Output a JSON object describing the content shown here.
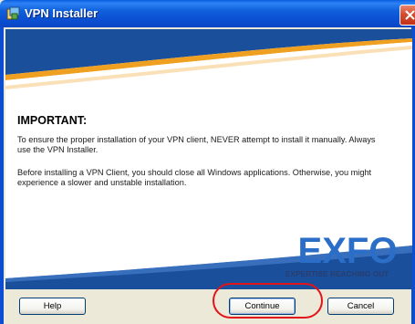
{
  "window": {
    "title": "VPN Installer",
    "icon": "installer-icon",
    "close_icon": "close-icon"
  },
  "content": {
    "heading": "IMPORTANT:",
    "paragraphs": [
      "To ensure the proper installation of your VPN client, NEVER attempt to install it manually. Always use the VPN Installer.",
      "Before installing a VPN Client, you should close all Windows applications. Otherwise, you might experience a slower and unstable installation."
    ]
  },
  "branding": {
    "logo_text": "EXFO",
    "tagline": "EXPERTISE REACHING OUT",
    "colors": {
      "banner_blue": "#1a4f9c",
      "banner_orange": "#f0a020",
      "logo_blue": "#2a6ec8"
    }
  },
  "buttons": {
    "help": "Help",
    "continue": "Continue",
    "cancel": "Cancel"
  },
  "annotation": {
    "highlight_color": "#e0141a"
  }
}
